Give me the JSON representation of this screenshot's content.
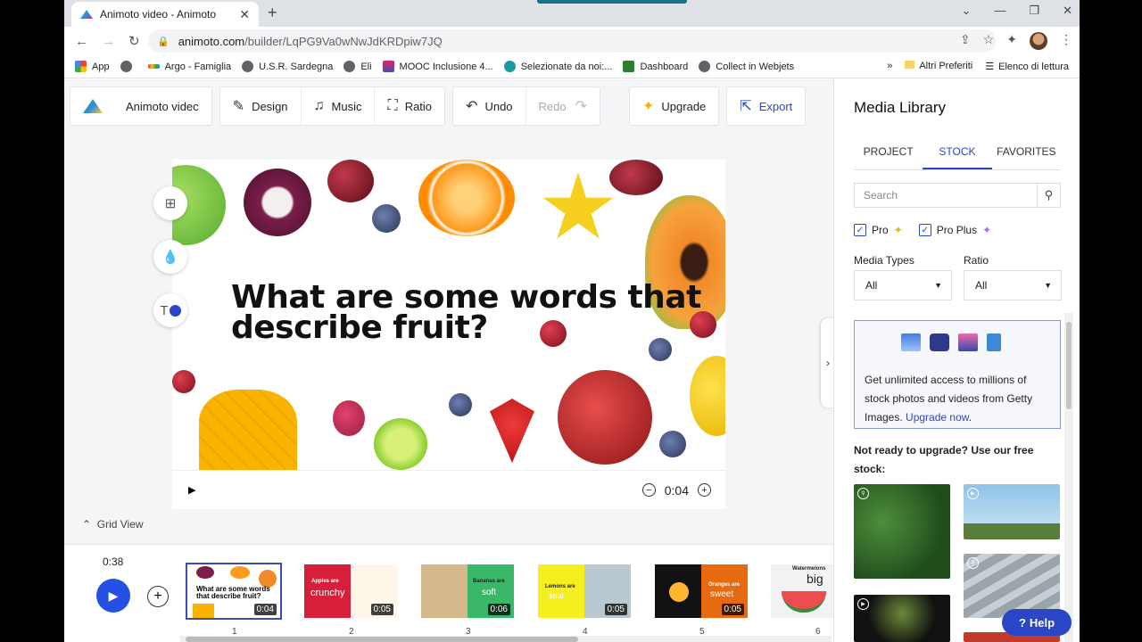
{
  "browser": {
    "tab_title": "Animoto video - Animoto",
    "url_host": "animoto.com",
    "url_path": "/builder/LqPG9Va0wNwJdKRDpiw7JQ",
    "bookmarks": [
      "App",
      "",
      "Argo - Famiglia",
      "U.S.R. Sardegna",
      "Eli",
      "MOOC Inclusione 4...",
      "Selezionate da noi:...",
      "Dashboard",
      "Collect in Webjets"
    ],
    "bookmarks_right": [
      "Altri Preferiti",
      "Elenco di lettura"
    ]
  },
  "toolbar": {
    "project_name": "Animoto videc",
    "design": "Design",
    "music": "Music",
    "ratio": "Ratio",
    "undo": "Undo",
    "redo": "Redo",
    "upgrade": "Upgrade",
    "export": "Export"
  },
  "canvas": {
    "question_line1": "What are some words that",
    "question_line2": "describe fruit?"
  },
  "player": {
    "duration": "0:04"
  },
  "grid_view_label": "Grid View",
  "timeline": {
    "total_time": "0:38",
    "scenes": [
      {
        "num": "1",
        "duration": "0:04",
        "text": "What are some words that describe fruit?"
      },
      {
        "num": "2",
        "duration": "0:05",
        "text_top": "Apples are",
        "text_big": "crunchy"
      },
      {
        "num": "3",
        "duration": "0:06",
        "text_top": "Bananas are",
        "text_big": "soft"
      },
      {
        "num": "4",
        "duration": "0:05",
        "text_top": "Lemons are",
        "text_big": "sour"
      },
      {
        "num": "5",
        "duration": "0:05",
        "text_top": "Oranges are",
        "text_big": "sweet"
      },
      {
        "num": "6",
        "duration": "",
        "text_top": "Watermelons",
        "text_big": "big"
      }
    ]
  },
  "library": {
    "title": "Media Library",
    "tabs": [
      "PROJECT",
      "STOCK",
      "FAVORITES"
    ],
    "active_tab": "STOCK",
    "search_placeholder": "Search",
    "pro_label": "Pro",
    "pro_plus_label": "Pro Plus",
    "media_types_label": "Media Types",
    "media_types_value": "All",
    "ratio_label": "Ratio",
    "ratio_value": "All",
    "promo_text": "Get unlimited access to millions of stock photos and videos from Getty Images.",
    "promo_link": "Upgrade now",
    "promo_end": ".",
    "free_text": "Not ready to upgrade? Use our free stock:",
    "help": "Help"
  },
  "colors": {
    "accent": "#2b46c5",
    "play_button": "#2550e6"
  }
}
